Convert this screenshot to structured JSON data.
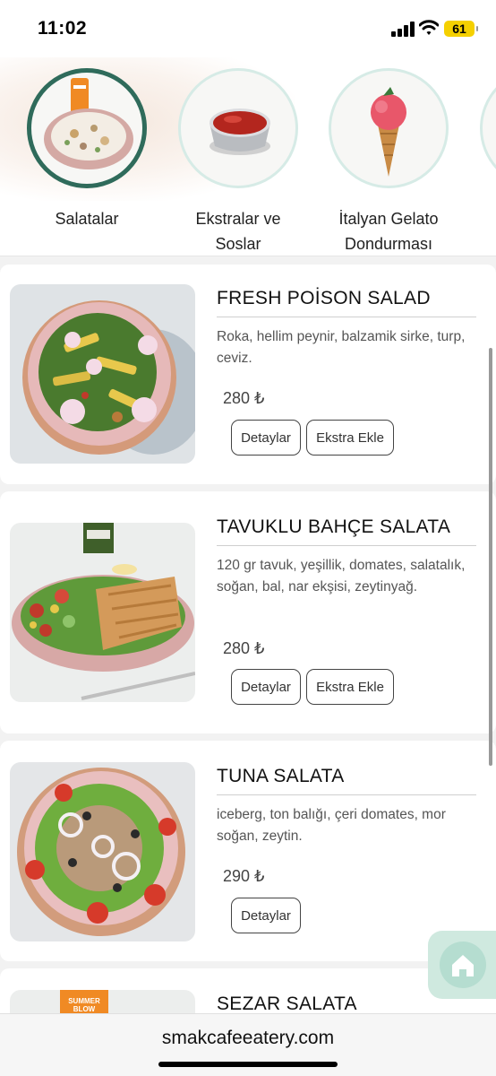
{
  "status": {
    "time": "11:02",
    "battery": "61"
  },
  "categories": [
    {
      "label": "Salatalar",
      "active": true
    },
    {
      "label": "Ekstralar ve Soslar",
      "active": false
    },
    {
      "label": "İtalyan Gelato Dondurması",
      "active": false
    }
  ],
  "products": [
    {
      "title": "FRESH POİSON SALAD",
      "description": "Roka, hellim peynir, balzamik sirke, turp, ceviz.",
      "price": "280 ₺",
      "details_label": "Detaylar",
      "extra_label": "Ekstra Ekle"
    },
    {
      "title": "TAVUKLU BAHÇE SALATA",
      "description": "120 gr tavuk, yeşillik, domates, salatalık, soğan, bal, nar ekşisi, zeytinyağ.",
      "price": "280 ₺",
      "details_label": "Detaylar",
      "extra_label": "Ekstra Ekle"
    },
    {
      "title": "TUNA SALATA",
      "description": "iceberg, ton balığı, çeri domates, mor soğan, zeytin.",
      "price": "290 ₺",
      "details_label": "Detaylar"
    },
    {
      "title": "SEZAR SALATA"
    }
  ],
  "image_text": {
    "juice_bottle": "SUMMER BLOW"
  },
  "browser": {
    "url": "smakcafeeatery.com"
  },
  "colors": {
    "active_ring": "#2f6b5b",
    "ring": "#d6ebe6",
    "home_fab": "#cfe9df"
  },
  "icons": {
    "home_button": "home-icon"
  }
}
